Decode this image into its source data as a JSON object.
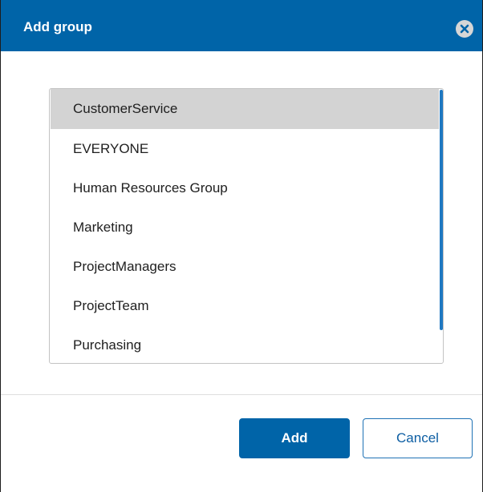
{
  "dialog": {
    "title": "Add group",
    "close_icon": "close-circle-icon"
  },
  "groups": {
    "selected_index": 0,
    "items": [
      {
        "label": "CustomerService"
      },
      {
        "label": "EVERYONE"
      },
      {
        "label": "Human Resources Group"
      },
      {
        "label": "Marketing"
      },
      {
        "label": "ProjectManagers"
      },
      {
        "label": "ProjectTeam"
      },
      {
        "label": "Purchasing"
      }
    ]
  },
  "buttons": {
    "add_label": "Add",
    "cancel_label": "Cancel"
  },
  "colors": {
    "header": "#0064a8",
    "selected_row": "#d3d3d3",
    "scrollbar": "#1f78c1",
    "cancel_border": "#1f72b5"
  }
}
